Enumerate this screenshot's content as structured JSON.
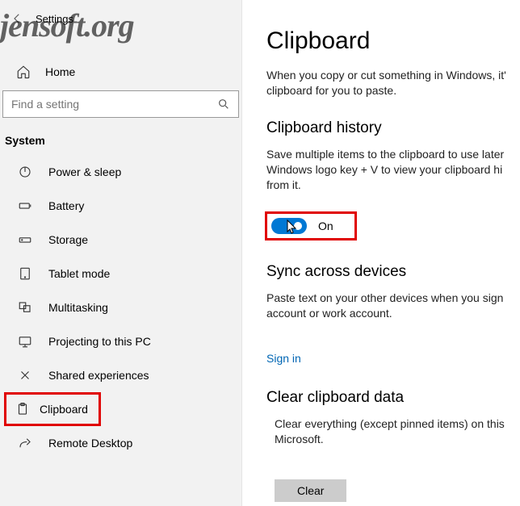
{
  "watermark": "jensoft.org",
  "header": {
    "settings_label": "Settings",
    "home_label": "Home"
  },
  "search": {
    "placeholder": "Find a setting"
  },
  "sidebar": {
    "category": "System",
    "items": [
      {
        "label": "Power & sleep"
      },
      {
        "label": "Battery"
      },
      {
        "label": "Storage"
      },
      {
        "label": "Tablet mode"
      },
      {
        "label": "Multitasking"
      },
      {
        "label": "Projecting to this PC"
      },
      {
        "label": "Shared experiences"
      },
      {
        "label": "Clipboard"
      },
      {
        "label": "Remote Desktop"
      }
    ]
  },
  "main": {
    "title": "Clipboard",
    "intro": "When you copy or cut something in Windows, it' clipboard for you to paste.",
    "history": {
      "title": "Clipboard history",
      "desc": "Save multiple items to the clipboard to use later Windows logo key + V to view your clipboard hi from it.",
      "toggle_state": "On"
    },
    "sync": {
      "title": "Sync across devices",
      "desc": "Paste text on your other devices when you sign account or work account.",
      "signin": "Sign in"
    },
    "clear": {
      "title": "Clear clipboard data",
      "desc": "Clear everything (except pinned items) on this Microsoft.",
      "button": "Clear"
    }
  }
}
